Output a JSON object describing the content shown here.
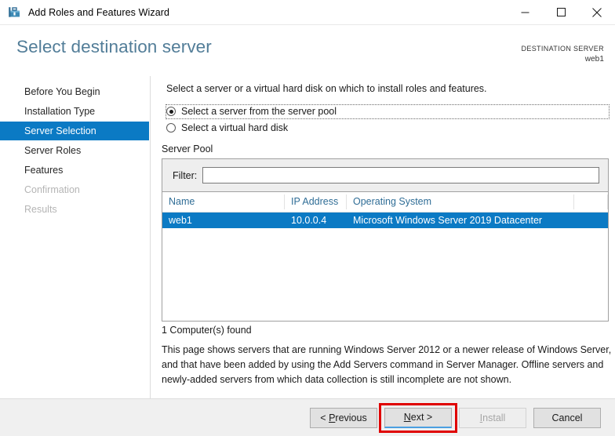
{
  "window": {
    "title": "Add Roles and Features Wizard",
    "icon": "wizard-toolbox-icon",
    "controls": {
      "minimize": "minimize-icon",
      "maximize": "maximize-icon",
      "close": "close-icon"
    }
  },
  "header": {
    "page_title": "Select destination server",
    "destination_label": "DESTINATION SERVER",
    "destination_value": "web1",
    "title_color": "#527d98"
  },
  "sidebar": {
    "items": [
      {
        "label": "Before You Begin",
        "state": "normal"
      },
      {
        "label": "Installation Type",
        "state": "normal"
      },
      {
        "label": "Server Selection",
        "state": "active"
      },
      {
        "label": "Server Roles",
        "state": "normal"
      },
      {
        "label": "Features",
        "state": "normal"
      },
      {
        "label": "Confirmation",
        "state": "disabled"
      },
      {
        "label": "Results",
        "state": "disabled"
      }
    ],
    "active_color": "#0b7ac4"
  },
  "main": {
    "intro": "Select a server or a virtual hard disk on which to install roles and features.",
    "options": [
      {
        "label": "Select a server from the server pool",
        "selected": true,
        "focused": true
      },
      {
        "label": "Select a virtual hard disk",
        "selected": false,
        "focused": false
      }
    ],
    "pool_label": "Server Pool",
    "filter": {
      "label": "Filter:",
      "value": "",
      "placeholder": ""
    },
    "table": {
      "columns": [
        "Name",
        "IP Address",
        "Operating System",
        ""
      ],
      "rows": [
        {
          "name": "web1",
          "ip": "10.0.0.4",
          "os": "Microsoft Windows Server 2019 Datacenter",
          "selected": true
        }
      ],
      "header_color": "#2f6d96",
      "selected_row_color": "#0b7ac4"
    },
    "found_text": "1 Computer(s) found",
    "description": "This page shows servers that are running Windows Server 2012 or a newer release of Windows Server, and that have been added by using the Add Servers command in Server Manager. Offline servers and newly-added servers from which data collection is still incomplete are not shown."
  },
  "footer": {
    "previous": {
      "prefix": "< ",
      "accel": "P",
      "rest": "revious",
      "enabled": true
    },
    "next": {
      "accel": "N",
      "rest": "ext >",
      "enabled": true,
      "focused": true,
      "annotated": true
    },
    "install": {
      "accel": "I",
      "rest": "nstall",
      "enabled": false
    },
    "cancel": {
      "label": "Cancel",
      "enabled": true
    },
    "annotation_color": "#e00000"
  }
}
